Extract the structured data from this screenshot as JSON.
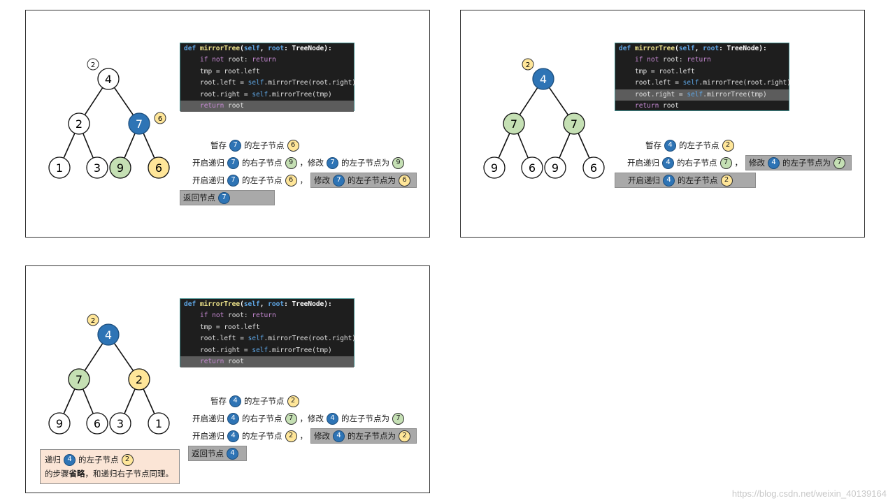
{
  "code": {
    "line1": {
      "def": "def ",
      "fn": "mirrorTree",
      "open": "(",
      "self": "self",
      "comma": ", ",
      "root": "root",
      "colon": ": ",
      "type": "TreeNode",
      "close": "):"
    },
    "line2": {
      "if": "if not",
      "rest": " root: ",
      "ret": "return"
    },
    "line3": "tmp = root.left",
    "line4": {
      "a": "root.left = ",
      "self": "self",
      "b": ".mirrorTree(root.right)"
    },
    "line5": {
      "a": "root.right = ",
      "self": "self",
      "b": ".mirrorTree(tmp)"
    },
    "line6": {
      "ret": "return",
      "rest": " root"
    }
  },
  "labels": {
    "store": "暂存",
    "of_left": "的左子节点",
    "of_right": "的右子节点",
    "start_rec": "开启递归",
    "modify": "修改",
    "set_left": "的左子节点为",
    "return_node": "返回节点",
    "comma": "，"
  },
  "colors": {
    "blue": "#2e74b5",
    "yellow": "#ffe699",
    "green": "#c5e0b4",
    "white": "#ffffff",
    "highlight": "#a9a9a9",
    "note": "#fbe5d6"
  },
  "panel1": {
    "badge": "2",
    "badge2": "6",
    "tree": [
      "4",
      "2",
      "7",
      "1",
      "3",
      "9",
      "6"
    ],
    "s1": {
      "a": "7",
      "b": "6"
    },
    "s2": {
      "a": "7",
      "b": "9",
      "c": "7",
      "d": "9"
    },
    "s3": {
      "a": "7",
      "b": "6",
      "c": "7",
      "d": "6"
    },
    "s4": {
      "a": "7"
    }
  },
  "panel2": {
    "badge": "2",
    "tree": [
      "4",
      "7",
      "7",
      "9",
      "6",
      "9",
      "6"
    ],
    "s1": {
      "a": "4",
      "b": "2"
    },
    "s2": {
      "a": "4",
      "b": "7",
      "c": "4",
      "d": "7"
    },
    "s3": {
      "a": "4",
      "b": "2"
    }
  },
  "panel3": {
    "badge": "2",
    "tree": [
      "4",
      "7",
      "2",
      "9",
      "6",
      "3",
      "1"
    ],
    "s1": {
      "a": "4",
      "b": "2"
    },
    "s2": {
      "a": "4",
      "b": "7",
      "c": "4",
      "d": "7"
    },
    "s3": {
      "a": "4",
      "b": "2",
      "c": "4",
      "d": "2"
    },
    "s4": {
      "a": "4"
    },
    "note": {
      "prefix": "递归",
      "a": "4",
      "mid": "的左子节点",
      "b": "2",
      "line2a": "的步骤",
      "line2b": "省略",
      "line2c": "，和递归右子节点同理。"
    }
  },
  "watermark": "https://blog.csdn.net/weixin_40139164"
}
